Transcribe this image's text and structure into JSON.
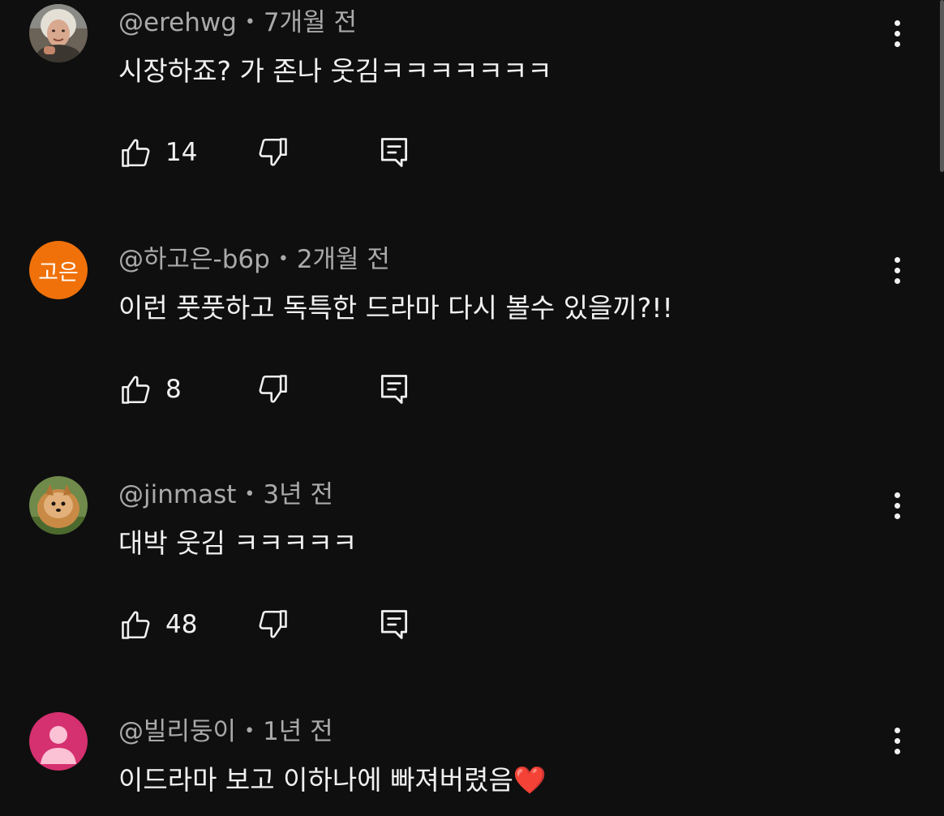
{
  "comments": [
    {
      "author": "@erehwg",
      "time": "7개월 전",
      "text": "시장하죠? 가 존나 웃김ㅋㅋㅋㅋㅋㅋㅋ",
      "likes": "14",
      "avatar": "photo-woman-icon"
    },
    {
      "author": "@하고은-b6p",
      "time": "2개월 전",
      "text": "이런 풋풋하고 독특한 드라마 다시 볼수 있을끼?!!",
      "likes": "8",
      "avatar_initials": "고은",
      "avatar_color": "#f0710a"
    },
    {
      "author": "@jinmast",
      "time": "3년 전",
      "text": "대박 웃김 ㅋㅋㅋㅋㅋ",
      "likes": "48",
      "avatar": "photo-pomeranian-icon"
    },
    {
      "author": "@빌리둥이",
      "time": "1년 전",
      "text": "이드라마 보고 이하나에 빠져버렸음",
      "emoji": "❤️",
      "avatar": "default-person-icon",
      "avatar_color": "#d5306f"
    }
  ],
  "separator": "•",
  "colors": {
    "background": "#0f0f0f",
    "primary_text": "#f1f1f1",
    "secondary_text": "#aaaaaa"
  }
}
